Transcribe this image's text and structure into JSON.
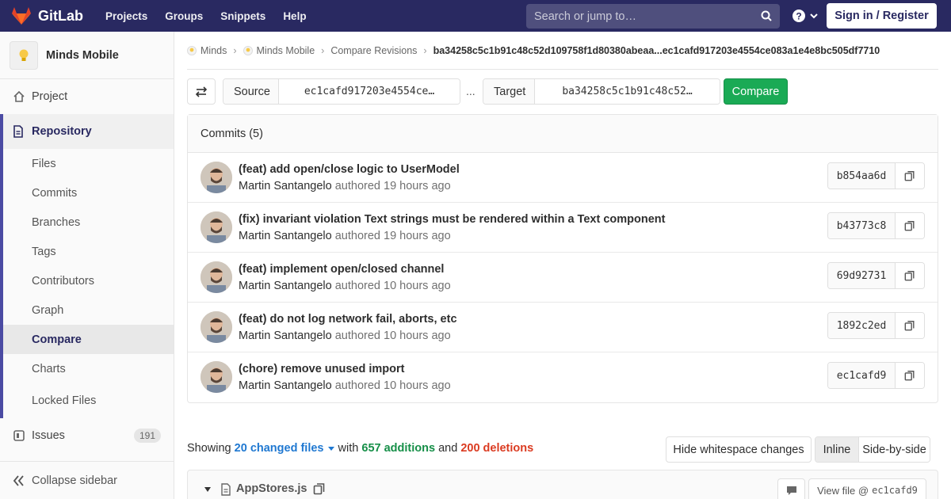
{
  "navbar": {
    "brand": "GitLab",
    "links": [
      "Projects",
      "Groups",
      "Snippets",
      "Help"
    ],
    "search_placeholder": "Search or jump to…",
    "signin_label": "Sign in / Register",
    "bg_color": "#292961"
  },
  "sidebar": {
    "project_name": "Minds Mobile",
    "project_item": "Project",
    "repository_label": "Repository",
    "repo_items": [
      "Files",
      "Commits",
      "Branches",
      "Tags",
      "Contributors",
      "Graph",
      "Compare",
      "Charts",
      "Locked Files"
    ],
    "active_item": "Compare",
    "issues_label": "Issues",
    "issues_count": "191",
    "collapse_label": "Collapse sidebar"
  },
  "breadcrumb": {
    "items": [
      "Minds",
      "Minds Mobile",
      "Compare Revisions"
    ],
    "current": "ba34258c5c1b91c48c52d109758f1d80380abeaa...ec1cafd917203e4554ce083a1e4e8bc505df7710"
  },
  "compare": {
    "source_label": "Source",
    "source_value": "ec1cafd917203e4554ce…",
    "separator": "...",
    "target_label": "Target",
    "target_value": "ba34258c5c1b91c48c52…",
    "compare_button": "Compare",
    "accent_color": "#1aaa55"
  },
  "commits": {
    "header": "Commits (5)",
    "items": [
      {
        "title": "(feat) add open/close logic to UserModel",
        "author": "Martin Santangelo",
        "authored": "authored",
        "time": "19 hours ago",
        "sha": "b854aa6d"
      },
      {
        "title": "(fix) invariant violation Text strings must be rendered within a Text component",
        "author": "Martin Santangelo",
        "authored": "authored",
        "time": "19 hours ago",
        "sha": "b43773c8"
      },
      {
        "title": "(feat) implement open/closed channel",
        "author": "Martin Santangelo",
        "authored": "authored",
        "time": "10 hours ago",
        "sha": "69d92731"
      },
      {
        "title": "(feat) do not log network fail, aborts, etc",
        "author": "Martin Santangelo",
        "authored": "authored",
        "time": "10 hours ago",
        "sha": "1892c2ed"
      },
      {
        "title": "(chore) remove unused import",
        "author": "Martin Santangelo",
        "authored": "authored",
        "time": "10 hours ago",
        "sha": "ec1cafd9"
      }
    ]
  },
  "summary": {
    "showing": "Showing",
    "changed_files": "20 changed files",
    "with": "with",
    "additions": "657 additions",
    "and": "and",
    "deletions": "200 deletions",
    "hide_whitespace": "Hide whitespace changes",
    "inline": "Inline",
    "side_by_side": "Side-by-side"
  },
  "file": {
    "name": "AppStores.js",
    "view_file_label": "View file @",
    "view_file_sha": "ec1cafd9"
  }
}
